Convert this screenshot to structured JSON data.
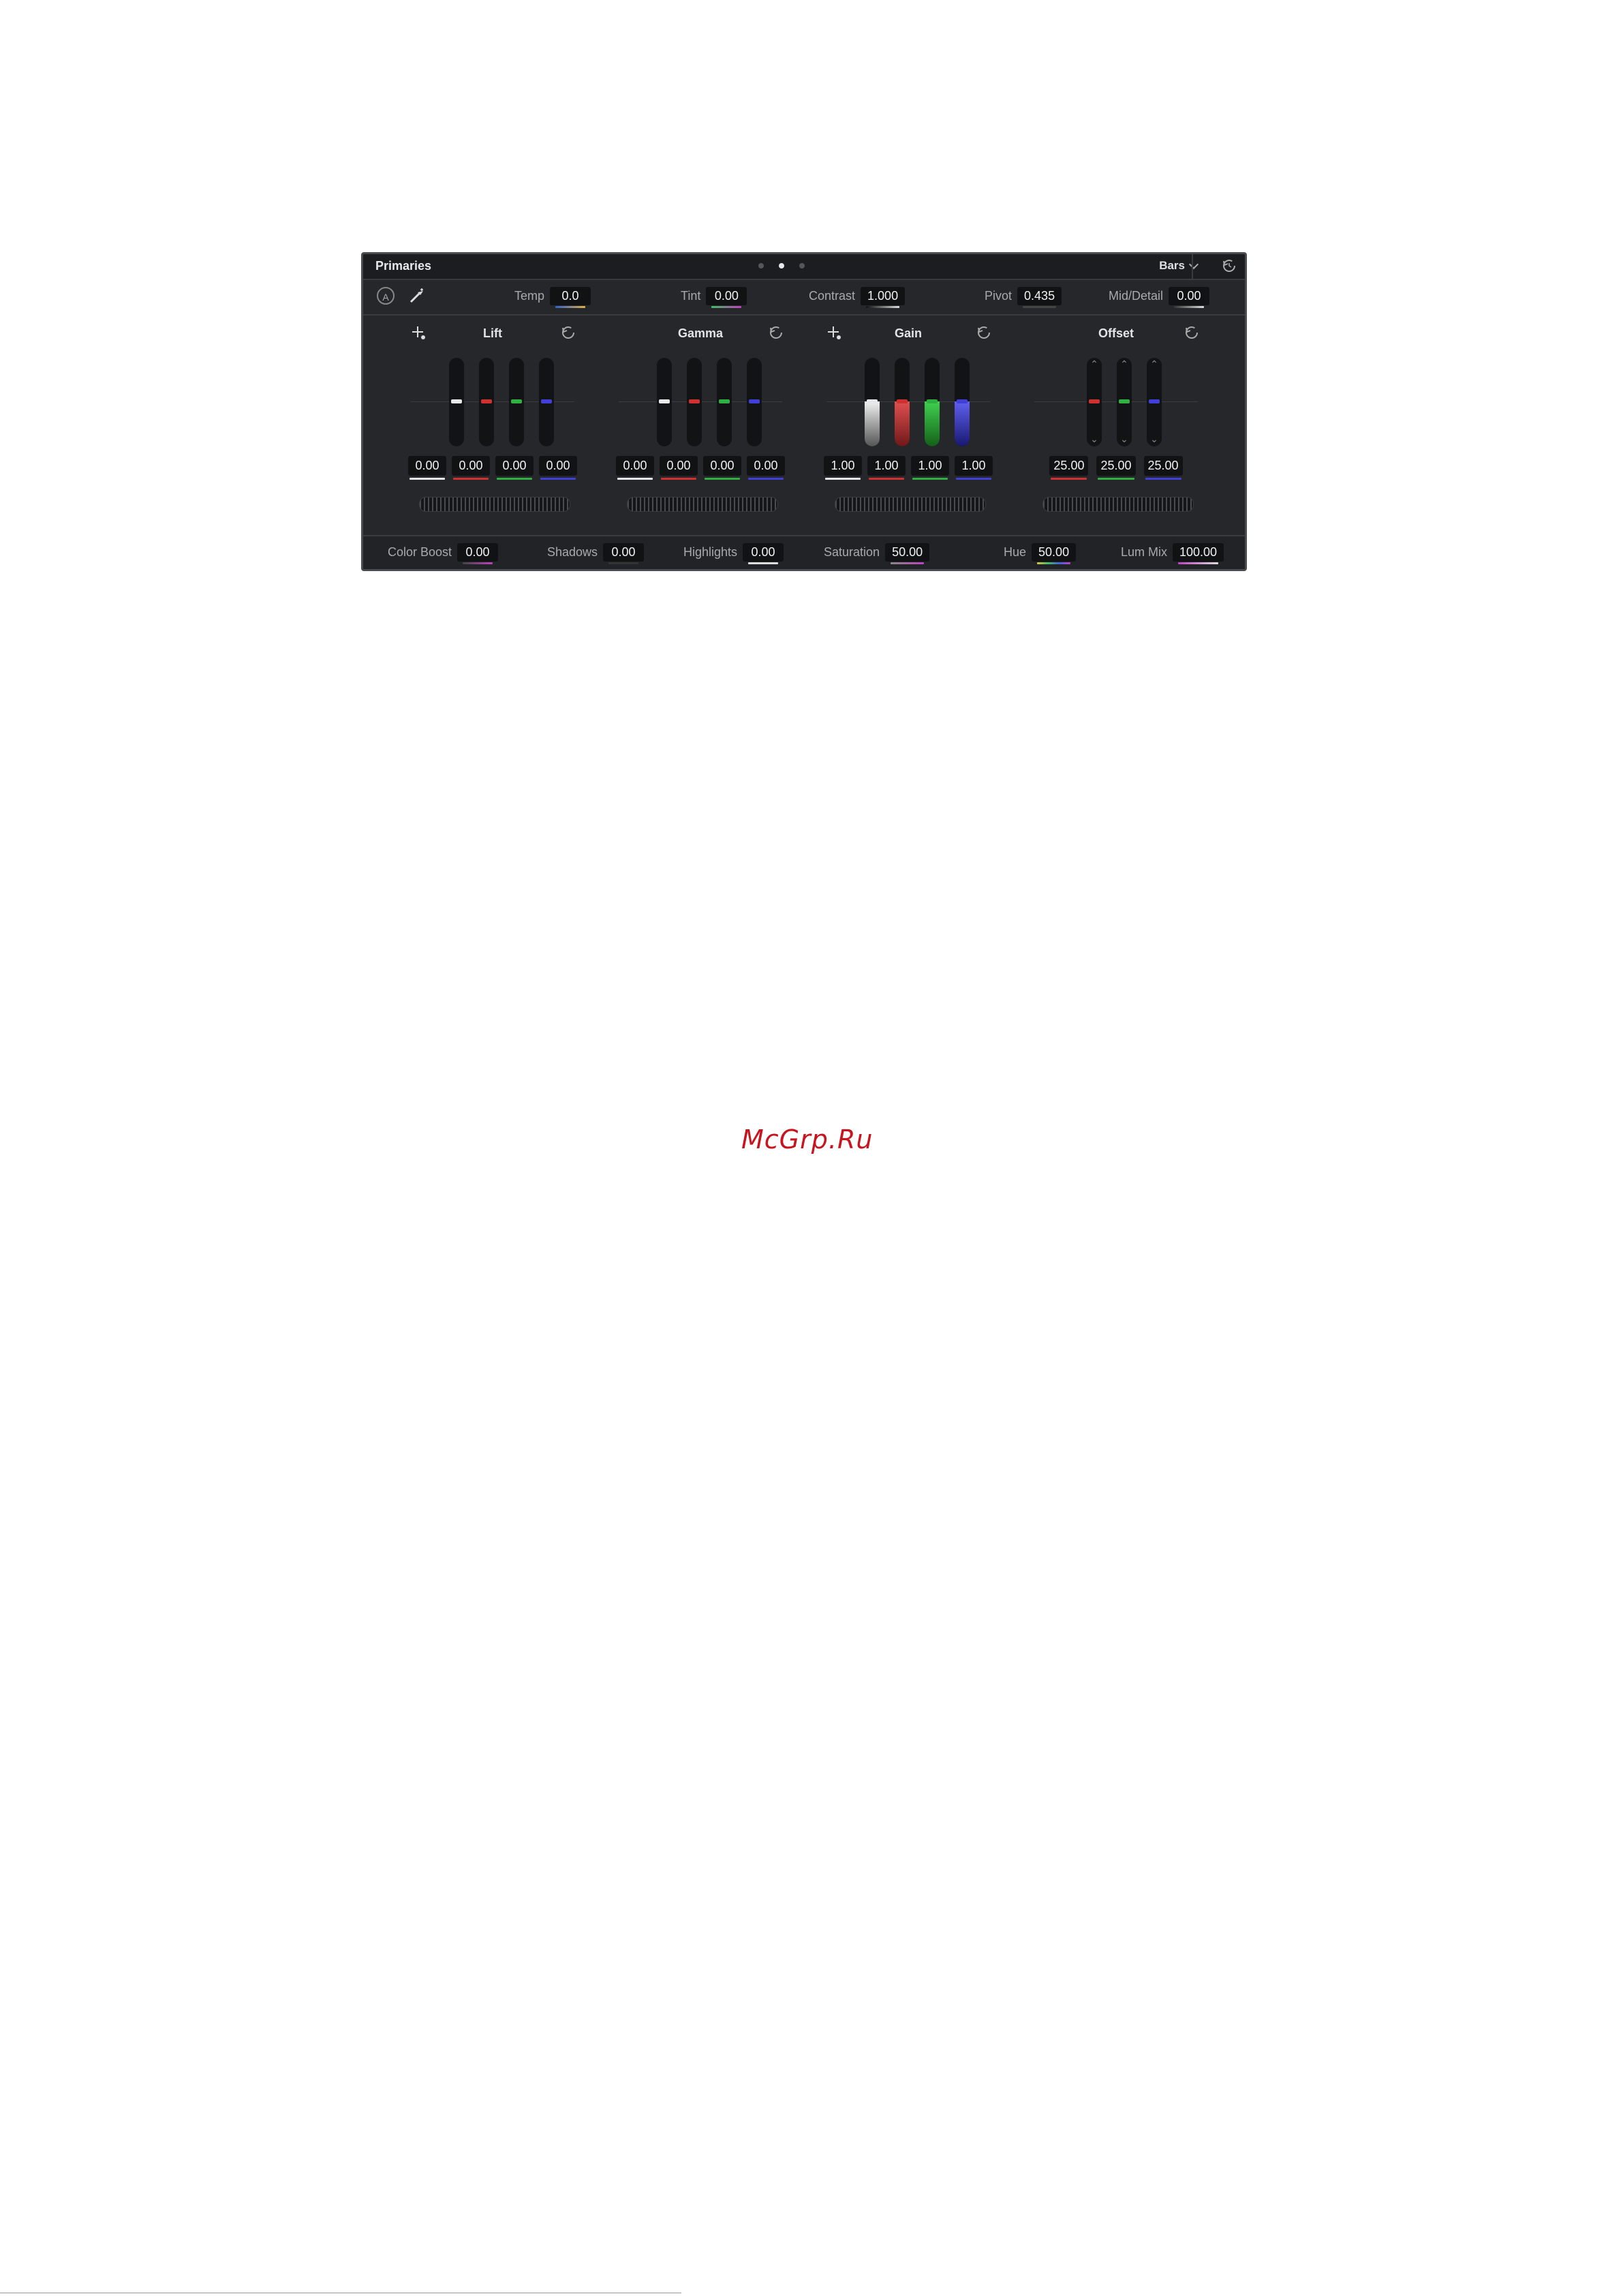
{
  "panel": {
    "title": "Primaries",
    "mode": "Bars",
    "auto_label": "A"
  },
  "top_params": [
    {
      "label": "Temp",
      "value": "0.0",
      "underline": "#e0b040"
    },
    {
      "label": "Tint",
      "value": "0.00",
      "underline": "#40c060"
    },
    {
      "label": "Contrast",
      "value": "1.000",
      "underline": "#dddddd"
    },
    {
      "label": "Pivot",
      "value": "0.435",
      "underline": "#555555"
    },
    {
      "label": "Mid/Detail",
      "value": "0.00",
      "underline": "#dddddd"
    }
  ],
  "wheels": [
    {
      "title": "Lift",
      "values": [
        "0.00",
        "0.00",
        "0.00",
        "0.00"
      ]
    },
    {
      "title": "Gamma",
      "values": [
        "0.00",
        "0.00",
        "0.00",
        "0.00"
      ]
    },
    {
      "title": "Gain",
      "values": [
        "1.00",
        "1.00",
        "1.00",
        "1.00"
      ]
    },
    {
      "title": "Offset",
      "values": [
        "25.00",
        "25.00",
        "25.00"
      ]
    }
  ],
  "bottom_params": [
    {
      "label": "Color Boost",
      "value": "0.00"
    },
    {
      "label": "Shadows",
      "value": "0.00"
    },
    {
      "label": "Highlights",
      "value": "0.00"
    },
    {
      "label": "Saturation",
      "value": "50.00"
    },
    {
      "label": "Hue",
      "value": "50.00"
    },
    {
      "label": "Lum Mix",
      "value": "100.00"
    }
  ],
  "channel_colors": {
    "y": "#e8e8ea",
    "r": "#d03030",
    "g": "#30b040",
    "b": "#4040d8"
  },
  "watermark": "McGrp.Ru"
}
